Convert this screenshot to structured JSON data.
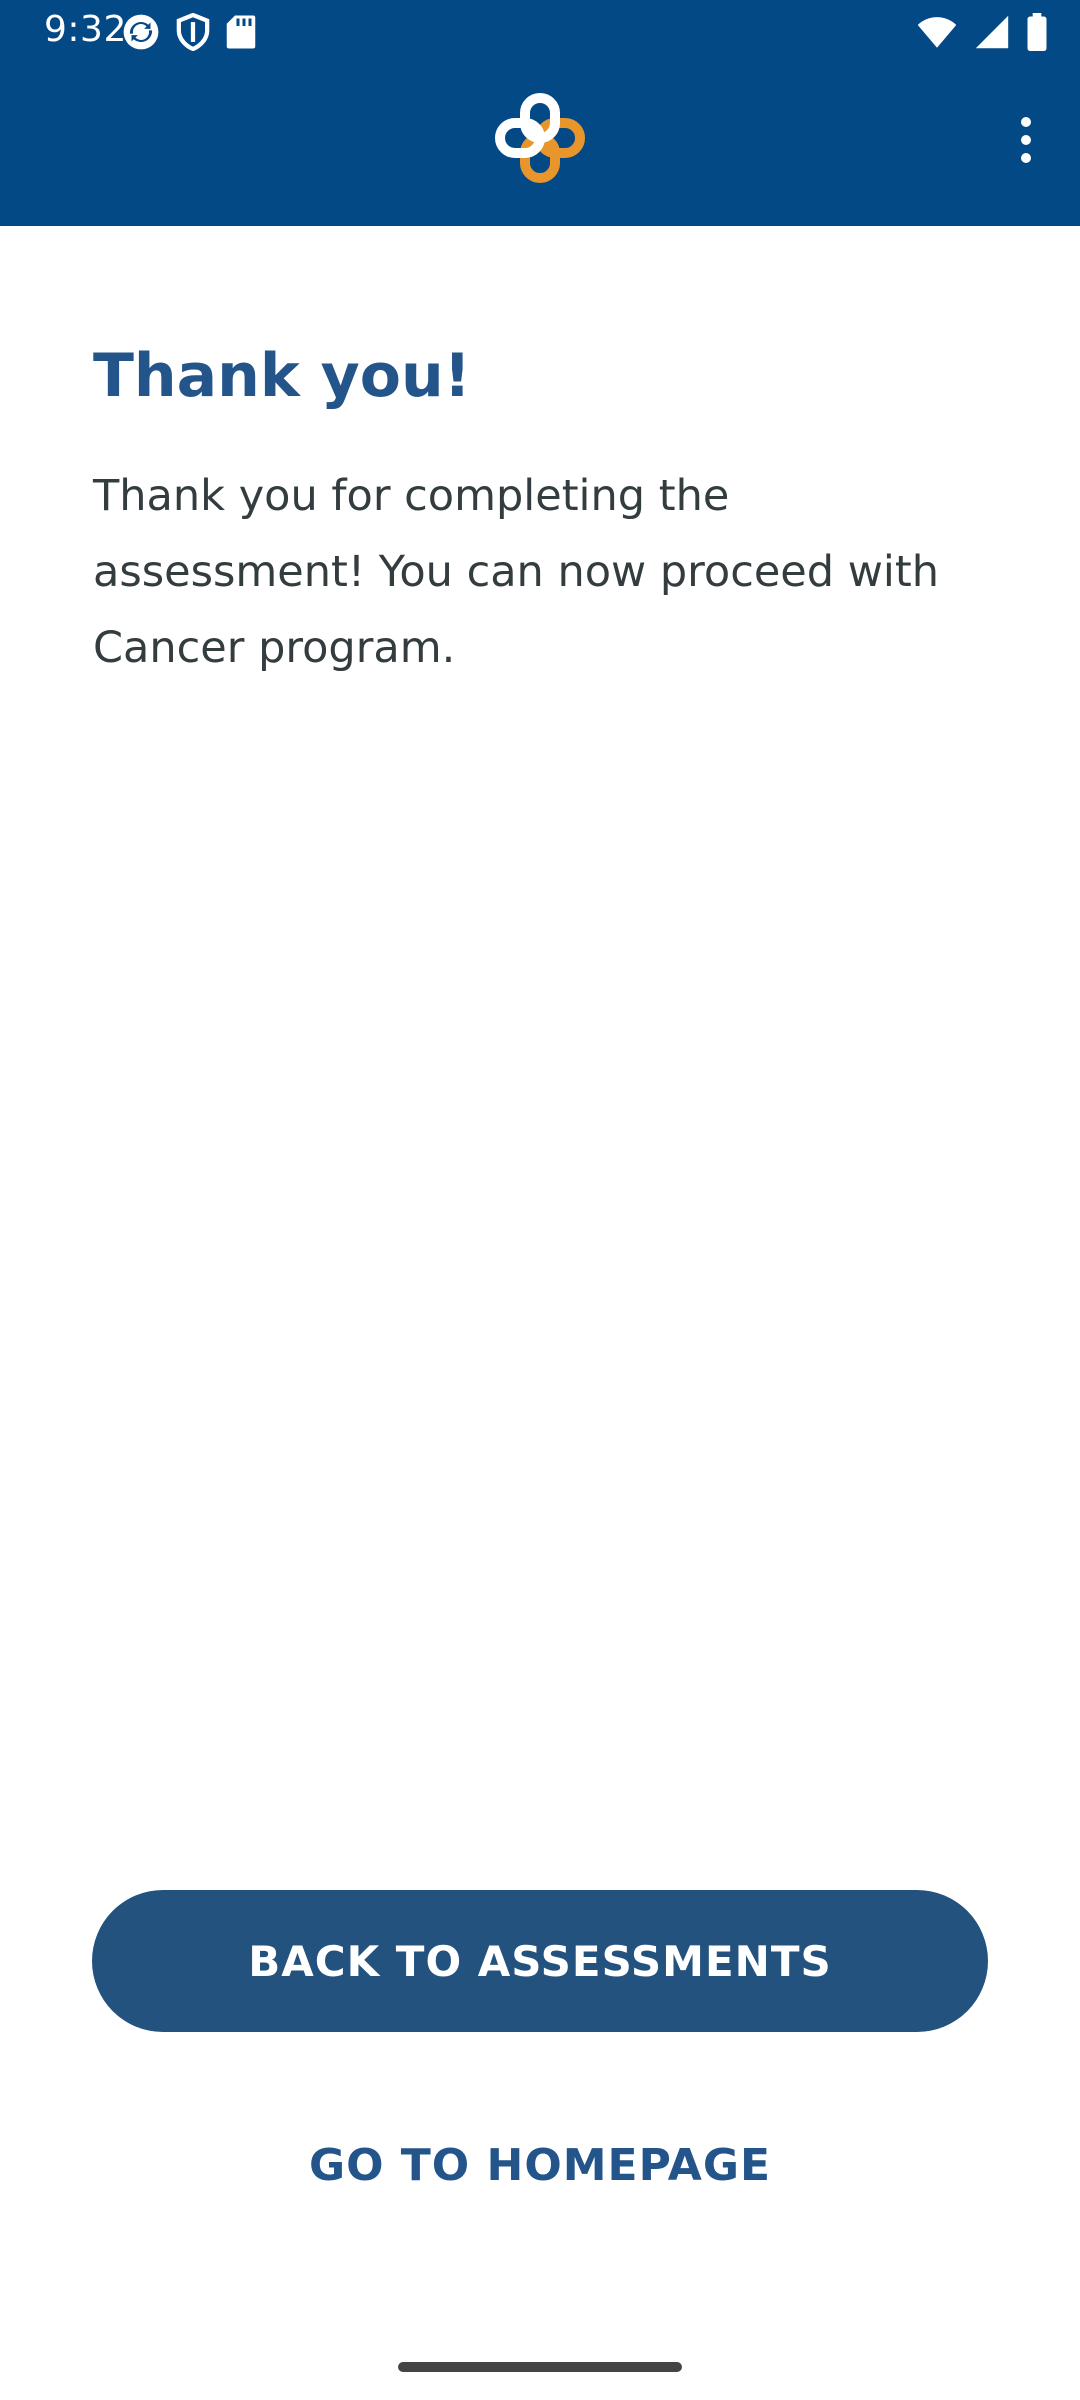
{
  "status_bar": {
    "time": "9:32",
    "left_icons": [
      "sync-icon",
      "shield-icon",
      "sd-card-icon"
    ],
    "right_icons": [
      "wifi-icon",
      "signal-icon",
      "battery-icon"
    ]
  },
  "app_bar": {
    "logo": "medical-cross-logo",
    "menu_icon": "more-vert-icon",
    "colors": {
      "background": "#034986",
      "logo_primary": "#ffffff",
      "logo_accent": "#e8952b"
    }
  },
  "main": {
    "title": "Thank you!",
    "body": "Thank you for completing the assessment! You can now proceed with Cancer program."
  },
  "actions": {
    "primary_label": "BACK TO ASSESSMENTS",
    "secondary_label": "GO TO HOMEPAGE"
  },
  "theme": {
    "title_color": "#23548a",
    "primary_button_color": "#23527f",
    "body_text_color": "#333c3f"
  }
}
